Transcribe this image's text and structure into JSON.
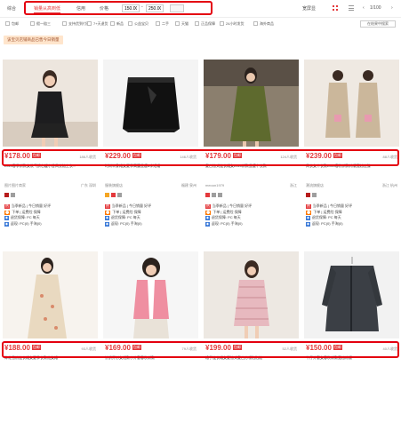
{
  "toolbar": {
    "sort_items": [
      "综合",
      "销量从高到低",
      "信用",
      "价格"
    ],
    "price_min": "150.00",
    "price_max": "250.00",
    "price_dash": "-",
    "view_label": "宽屏显",
    "pager": "1/100"
  },
  "filters": {
    "items": [
      "包邮",
      "假一赔三",
      "支持货到付款",
      "7+天退货",
      "新品",
      "公益宝贝",
      "二手",
      "天猫",
      "正品保障",
      "24小时发货",
      "海外商品"
    ],
    "search_placeholder": "在结果中搜索"
  },
  "section_label": "该宝贝店铺商品已售今日销量",
  "products": [
    {
      "price": "¥178.00",
      "tag": "包邮",
      "sold": "186人收货",
      "title": "2020春季新款女装气质名媛小香风长袖上衣...",
      "shop": "图片图片商家",
      "loc": "广东 深圳",
      "lines": [
        "当季新品 | 今日销量 好评",
        "下单 | 运费险 保障",
        "退货保障: PC 每天",
        "返现: PC(0) 手淘(0)"
      ]
    },
    {
      "price": "¥229.00",
      "tag": "包邮",
      "sold": "146人收货",
      "title": "时尚半身裙女夏季高腰显瘦a字短裙",
      "shop": "服装旗舰店",
      "loc": "福建 泉州",
      "lines": [
        "当季新品 | 今日销量 好评",
        "下单 | 运费险 保障",
        "退货保障: PC 每天",
        "返现: PC(0) 手淘(0)"
      ]
    },
    {
      "price": "¥179.00",
      "tag": "包邮",
      "sold": "124人收货",
      "title": "复古法式连衣裙女2020新款显瘦中长款",
      "shop": "meoon1979",
      "loc": "浙江",
      "lines": [
        "当季新品 | 今日销量 好评",
        "下单 | 运费险 保障",
        "退货保障: PC 每天",
        "返现: PC(0) 手淘(0)"
      ]
    },
    {
      "price": "¥239.00",
      "tag": "包邮",
      "sold": "88人收货",
      "title": "风衣女中长款2020春秋新款韩版宽松过膝",
      "shop": "潮流旗舰店",
      "loc": "浙江 杭州",
      "lines": [
        "当季新品 | 今日销量 好评",
        "下单 | 运费险 保障",
        "退货保障: PC 每天",
        "返现: PC(0) 手淘(0)"
      ]
    },
    {
      "price": "¥188.00",
      "tag": "包邮",
      "sold": "93人收货",
      "title": "碎花雪纺连衣裙女夏季长款仙女裙",
      "shop": "",
      "loc": "",
      "lines": []
    },
    {
      "price": "¥169.00",
      "tag": "包邮",
      "sold": "79人收货",
      "title": "针织开衫女短款小外套春秋新款",
      "shop": "",
      "loc": "",
      "lines": []
    },
    {
      "price": "¥199.00",
      "tag": "包邮",
      "sold": "52人收货",
      "title": "格子连衣裙女夏法式复古方领泡泡袖",
      "shop": "",
      "loc": "",
      "lines": []
    },
    {
      "price": "¥150.00",
      "tag": "包邮",
      "sold": "40人收货",
      "title": "牛仔外套女春秋新款宽松韩版",
      "shop": "",
      "loc": "",
      "lines": []
    }
  ]
}
